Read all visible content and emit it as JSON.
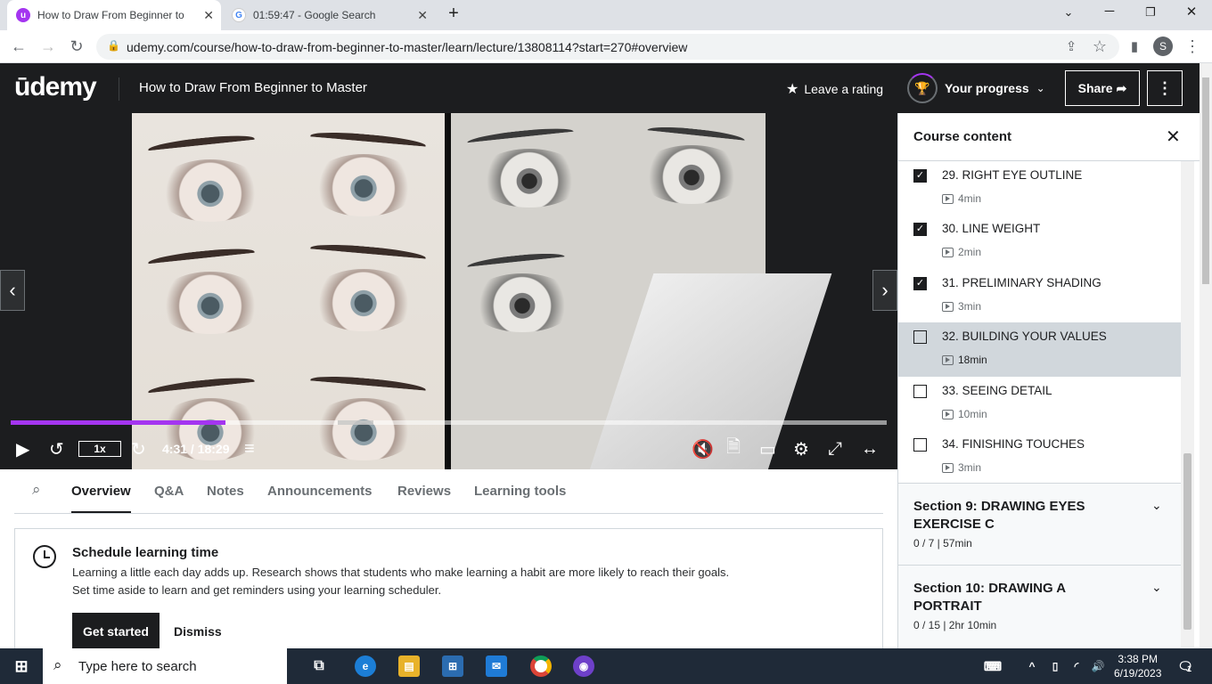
{
  "browser": {
    "tabs": [
      {
        "title": "How to Draw From Beginner to M",
        "active": true
      },
      {
        "title": "01:59:47 - Google Search",
        "active": false
      }
    ],
    "url": "udemy.com/course/how-to-draw-from-beginner-to-master/learn/lecture/13808114?start=270#overview",
    "profile_initial": "S"
  },
  "header": {
    "logo": "ūdemy",
    "course_title": "How to Draw From Beginner to Master",
    "rating_label": "Leave a rating",
    "progress_label": "Your progress",
    "share_label": "Share"
  },
  "player": {
    "speed": "1x",
    "time": "4:31 / 18:29",
    "progress_fraction": 0.245
  },
  "content_tabs": [
    "Overview",
    "Q&A",
    "Notes",
    "Announcements",
    "Reviews",
    "Learning tools"
  ],
  "schedule": {
    "title": "Schedule learning time",
    "line1": "Learning a little each day adds up. Research shows that students who make learning a habit are more likely to reach their goals.",
    "line2": "Set time aside to learn and get reminders using your learning scheduler.",
    "start_label": "Get started",
    "dismiss_label": "Dismiss"
  },
  "sidebar": {
    "title": "Course content",
    "lectures": [
      {
        "title": "29. RIGHT EYE OUTLINE",
        "duration": "4min",
        "done": true
      },
      {
        "title": "30. LINE WEIGHT",
        "duration": "2min",
        "done": true
      },
      {
        "title": "31. PRELIMINARY SHADING",
        "duration": "3min",
        "done": true
      },
      {
        "title": "32. BUILDING YOUR VALUES",
        "duration": "18min",
        "done": false,
        "current": true
      },
      {
        "title": "33. SEEING DETAIL",
        "duration": "10min",
        "done": false
      },
      {
        "title": "34. FINISHING TOUCHES",
        "duration": "3min",
        "done": false
      }
    ],
    "sections": [
      {
        "title": "Section 9: DRAWING EYES EXERCISE C",
        "meta": "0 / 7 | 57min"
      },
      {
        "title": "Section 10: DRAWING A PORTRAIT",
        "meta": "0 / 15 | 2hr 10min"
      }
    ]
  },
  "taskbar": {
    "search_placeholder": "Type here to search",
    "time": "3:38 PM",
    "date": "6/19/2023",
    "notification_count": "1"
  },
  "colors": {
    "accent": "#a435f0",
    "dark": "#1c1d1f"
  }
}
